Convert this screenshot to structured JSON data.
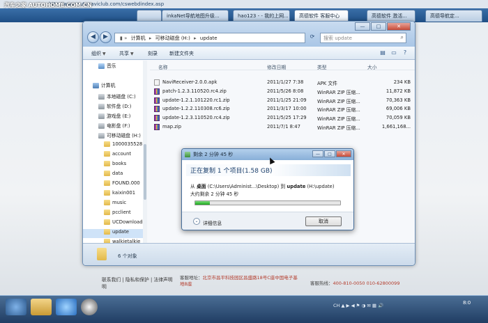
{
  "watermark": "汽车之家  AUTOHOME.COM.CN",
  "browser": {
    "url": "http://www.autonaviclub.com/cswebdindex.asp",
    "tabs": [
      {
        "label": "",
        "active": false
      },
      {
        "label": "inkaNet导航地图升级...",
        "active": false
      },
      {
        "label": "hao123 - - 我的上网...",
        "active": false
      },
      {
        "label": "高德软件 客服中心",
        "active": true
      },
      {
        "label": "高德软件 激活...",
        "active": false
      },
      {
        "label": "高德导航定...",
        "active": false
      }
    ]
  },
  "explorer": {
    "breadcrumb": [
      "计算机",
      "可移动磁盘 (H:)",
      "update"
    ],
    "search_placeholder": "搜索 update",
    "toolbar": {
      "organize": "组织",
      "share": "共享",
      "burn": "刻录",
      "new_folder": "新建文件夹"
    },
    "window_controls": {
      "min": "—",
      "max": "□",
      "close": "✕"
    },
    "nav": [
      {
        "label": "音乐",
        "icon": "music-icon",
        "indent": 1,
        "selected": false
      },
      {
        "label": "计算机",
        "icon": "computer-icon",
        "indent": 0,
        "selected": false
      },
      {
        "label": "本地磁盘 (C:)",
        "icon": "drive-icon",
        "indent": 1,
        "selected": false
      },
      {
        "label": "软件盘 (D:)",
        "icon": "drive-icon",
        "indent": 1,
        "selected": false
      },
      {
        "label": "游戏盘 (E:)",
        "icon": "drive-icon",
        "indent": 1,
        "selected": false
      },
      {
        "label": "电影盘 (F:)",
        "icon": "drive-icon",
        "indent": 1,
        "selected": false
      },
      {
        "label": "可移动磁盘 (H:)",
        "icon": "drive-icon",
        "indent": 1,
        "selected": false
      },
      {
        "label": "1000035528",
        "icon": "folder-icon",
        "indent": 2,
        "selected": false
      },
      {
        "label": "account",
        "icon": "folder-icon",
        "indent": 2,
        "selected": false
      },
      {
        "label": "books",
        "icon": "folder-icon",
        "indent": 2,
        "selected": false
      },
      {
        "label": "data",
        "icon": "folder-icon",
        "indent": 2,
        "selected": false
      },
      {
        "label": "FOUND.000",
        "icon": "folder-icon",
        "indent": 2,
        "selected": false
      },
      {
        "label": "kaixin001",
        "icon": "folder-icon",
        "indent": 2,
        "selected": false
      },
      {
        "label": "music",
        "icon": "folder-icon",
        "indent": 2,
        "selected": false
      },
      {
        "label": "pcclient",
        "icon": "folder-icon",
        "indent": 2,
        "selected": false
      },
      {
        "label": "UCDownloads",
        "icon": "folder-icon",
        "indent": 2,
        "selected": false
      },
      {
        "label": "update",
        "icon": "folder-icon",
        "indent": 2,
        "selected": true
      },
      {
        "label": "walkietalkie",
        "icon": "folder-icon",
        "indent": 2,
        "selected": false
      }
    ],
    "columns": {
      "name": "名称",
      "modified": "修改日期",
      "type": "类型",
      "size": "大小"
    },
    "files": [
      {
        "name": "NaviReceiver-2.0.0.apk",
        "modified": "2011/1/27 7:38",
        "type": "APK 文件",
        "size": "234 KB",
        "kind": "apk"
      },
      {
        "name": "patch-1.2.3.110520.rc4.zip",
        "modified": "2011/5/26 8:08",
        "type": "WinRAR ZIP 压缩...",
        "size": "11,872 KB",
        "kind": "zip"
      },
      {
        "name": "update-1.2.1.101220.rc1.zip",
        "modified": "2011/1/25 21:09",
        "type": "WinRAR ZIP 压缩...",
        "size": "70,363 KB",
        "kind": "zip"
      },
      {
        "name": "update-1.2.2.110308.rc6.zip",
        "modified": "2011/3/17 10:00",
        "type": "WinRAR ZIP 压缩...",
        "size": "69,006 KB",
        "kind": "zip"
      },
      {
        "name": "update-1.2.3.110520.rc4.zip",
        "modified": "2011/5/25 17:29",
        "type": "WinRAR ZIP 压缩...",
        "size": "70,059 KB",
        "kind": "zip"
      },
      {
        "name": "map.zip",
        "modified": "2011/7/1 8:47",
        "type": "WinRAR ZIP 压缩...",
        "size": "1,661,168...",
        "kind": "zip"
      }
    ],
    "status": "6 个对象"
  },
  "copy_dialog": {
    "title": "剩余 2 分钟 45 秒",
    "heading": "正在复制 1 个项目(1.58 GB)",
    "from_prefix": "从 ",
    "from_bold": "桌面",
    "from_path": " (C:\\Users\\Administ...\\Desktop) 到 ",
    "to_bold": "update",
    "to_path": " (H:\\update)",
    "remaining": "大约剩余 2 分钟 45 秒",
    "progress_percent": 10,
    "more_info": "详细信息",
    "cancel": "取消"
  },
  "web_footer": {
    "links": "联系我们 | 隐私和保护 | 法律声明",
    "links2": "明",
    "address_label": "客服地址：",
    "address": "北京市昌平科技园区昌盛路18号C座中国电子基地B座",
    "phone_label": "客服热线：",
    "phone": "400-810-0050  010-62800099"
  },
  "tray": "CH  ▲  ▶  ◀  ⚑  ◑  ✉  ▦  🔊",
  "clock": "8:0"
}
